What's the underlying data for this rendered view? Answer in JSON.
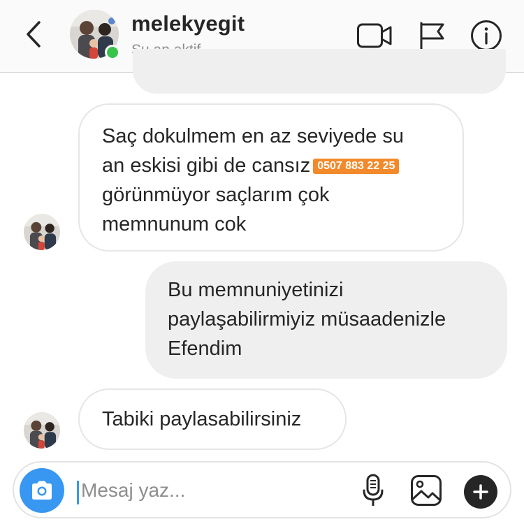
{
  "header": {
    "username": "melekyegit",
    "status": "Şu an aktif",
    "icons": [
      "back-chevron-icon",
      "video-camera-icon",
      "flag-icon",
      "info-icon"
    ],
    "online_color": "#3ac34a"
  },
  "messages": [
    {
      "sender": "contact",
      "lines": [
        "Saç dokulmem en az seviyede su",
        "an eskisi gibi de cansız",
        "görünmüyor saçlarım çok",
        "memnunum cok"
      ],
      "phone_badge": "0507 883 22 25"
    },
    {
      "sender": "me",
      "lines": [
        "Bu memnuniyetinizi",
        "paylaşabilirmiyiz müsaadenizle",
        "Efendim"
      ]
    },
    {
      "sender": "contact",
      "lines": [
        "Tabiki paylasabilirsiniz"
      ]
    }
  ],
  "composer": {
    "placeholder": "Mesaj yaz...",
    "icons": [
      "camera-icon",
      "microphone-icon",
      "gallery-icon",
      "plus-icon"
    ],
    "accent_color": "#3897f0"
  },
  "colors": {
    "badge": "#f28a2b",
    "outgoing_bubble": "#efefef",
    "incoming_border": "#e6e6e6"
  }
}
